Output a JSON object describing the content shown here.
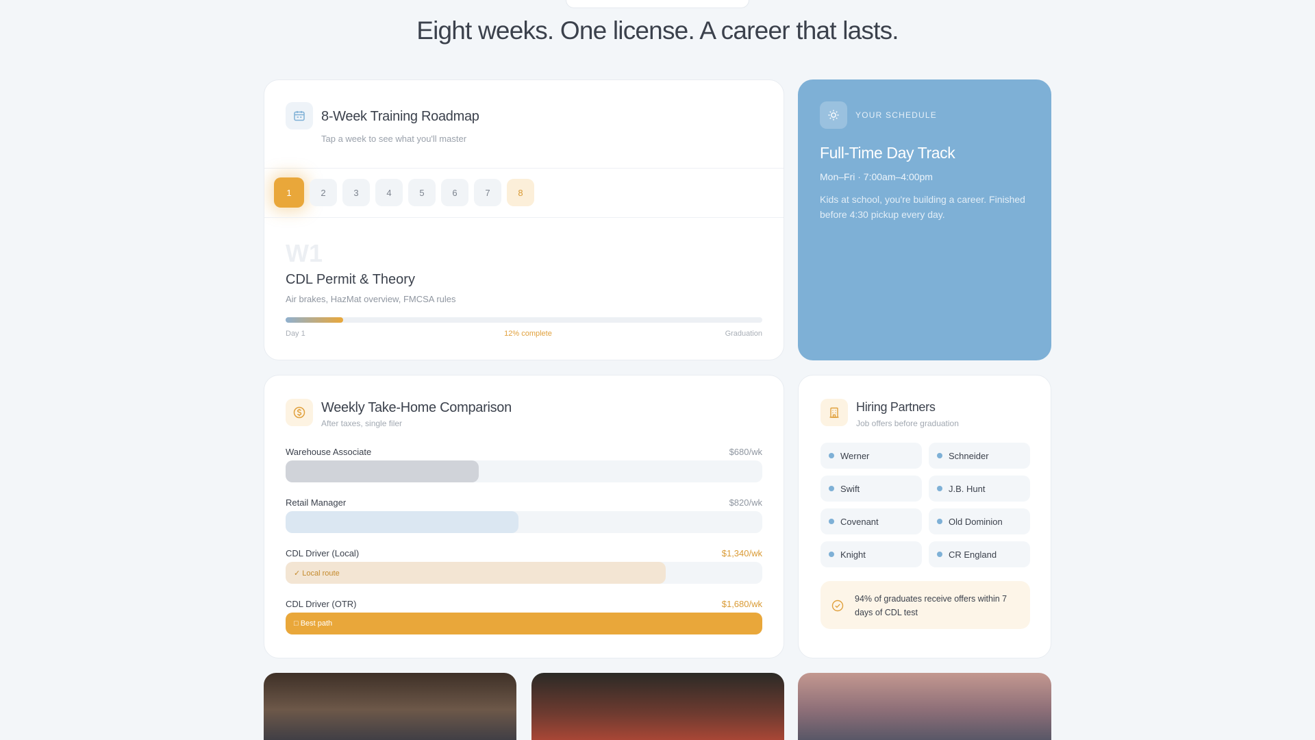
{
  "hero": {
    "title": "Eight weeks. One license. A career that lasts."
  },
  "roadmap": {
    "title": "8-Week Training Roadmap",
    "subtitle": "Tap a week to see what you'll master",
    "weeks": [
      "1",
      "2",
      "3",
      "4",
      "5",
      "6",
      "7",
      "8"
    ],
    "selected_week": "1",
    "week_code": "W1",
    "week_title": "CDL Permit & Theory",
    "week_desc": "Air brakes, HazMat overview, FMCSA rules",
    "progress_percent": 12,
    "progress_start": "Day 1",
    "progress_label": "12% complete",
    "progress_end": "Graduation"
  },
  "schedule": {
    "kicker": "YOUR SCHEDULE",
    "title": "Full-Time Day Track",
    "time": "Mon–Fri · 7:00am–4:00pm",
    "desc": "Kids at school, you're building a career. Finished before 4:30 pickup every day."
  },
  "pay": {
    "title": "Weekly Take-Home Comparison",
    "subtitle": "After taxes, single filer",
    "max_value": 1680,
    "rows": [
      {
        "name": "Warehouse Associate",
        "amount": "$680/wk",
        "value": 680,
        "tag": ""
      },
      {
        "name": "Retail Manager",
        "amount": "$820/wk",
        "value": 820,
        "tag": ""
      },
      {
        "name": "CDL Driver (Local)",
        "amount": "$1,340/wk",
        "value": 1340,
        "tag": "✓ Local route"
      },
      {
        "name": "CDL Driver (OTR)",
        "amount": "$1,680/wk",
        "value": 1680,
        "tag": "□ Best path"
      }
    ]
  },
  "partners": {
    "title": "Hiring Partners",
    "subtitle": "Job offers before graduation",
    "items": [
      "Werner",
      "Schneider",
      "Swift",
      "J.B. Hunt",
      "Covenant",
      "Old Dominion",
      "Knight",
      "CR England"
    ],
    "offer_text": "94% of graduates receive offers within 7 days of CDL test"
  },
  "colors": {
    "accent": "#e9a73a",
    "accent_soft": "#fcefd9",
    "schedule_bg": "#7eb0d6",
    "bg": "#f3f6f9"
  },
  "icons": {
    "roadmap": "calendar-icon",
    "schedule": "sun-icon",
    "pay": "dollar-icon",
    "partners": "building-icon",
    "offer": "check-circle-icon"
  }
}
